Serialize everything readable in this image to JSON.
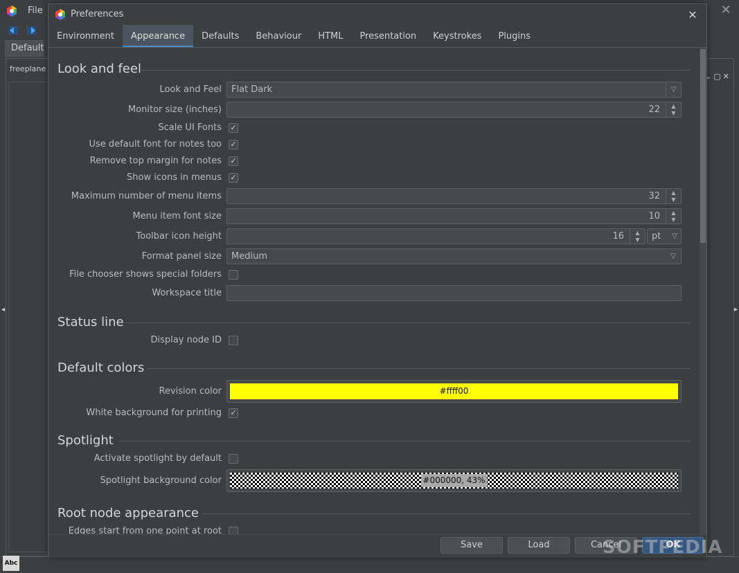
{
  "app": {
    "menu_file": "File",
    "tab_default": "Default",
    "map_tab": "freeplane",
    "abc": "Abc"
  },
  "dialog": {
    "title": "Preferences",
    "tabs": [
      "Environment",
      "Appearance",
      "Defaults",
      "Behaviour",
      "HTML",
      "Presentation",
      "Keystrokes",
      "Plugins"
    ],
    "active_tab": "Appearance"
  },
  "sections": {
    "look_and_feel": {
      "title": "Look and feel",
      "look_and_feel_label": "Look and Feel",
      "look_and_feel_value": "Flat Dark",
      "monitor_size_label": "Monitor size (inches)",
      "monitor_size_value": "22",
      "scale_ui_fonts_label": "Scale UI Fonts",
      "scale_ui_fonts": true,
      "default_font_notes_label": "Use default font for notes too",
      "default_font_notes": true,
      "remove_margin_label": "Remove top margin for notes",
      "remove_margin": true,
      "show_icons_label": "Show icons in menus",
      "show_icons": true,
      "max_menu_items_label": "Maximum number of menu items",
      "max_menu_items_value": "32",
      "menu_font_size_label": "Menu item font size",
      "menu_font_size_value": "10",
      "toolbar_icon_height_label": "Toolbar icon height",
      "toolbar_icon_height_value": "16",
      "toolbar_icon_unit": "pt",
      "format_panel_label": "Format panel size",
      "format_panel_value": "Medium",
      "file_chooser_label": "File chooser shows special folders",
      "file_chooser": false,
      "workspace_title_label": "Workspace title",
      "workspace_title_value": ""
    },
    "status_line": {
      "title": "Status line",
      "display_node_id_label": "Display node ID",
      "display_node_id": false
    },
    "default_colors": {
      "title": "Default colors",
      "revision_color_label": "Revision color",
      "revision_color_value": "#ffff00",
      "white_bg_label": "White background for printing",
      "white_bg": true
    },
    "spotlight": {
      "title": "Spotlight",
      "activate_label": "Activate spotlight by default",
      "activate": false,
      "bg_color_label": "Spotlight background color",
      "bg_color_value": "#000000, 43%"
    },
    "root_node": {
      "title": "Root node appearance",
      "edges_label": "Edges start from one point at root node",
      "edges": false
    }
  },
  "buttons": {
    "save": "Save",
    "load": "Load",
    "cancel": "Cancel",
    "ok": "OK"
  },
  "icons": {
    "check": "✓",
    "close": "✕",
    "chevron": "⌵"
  },
  "colors": {
    "revision": "#ffff00",
    "accent": "#4a88c7"
  },
  "watermark": "SOFTPEDIA"
}
